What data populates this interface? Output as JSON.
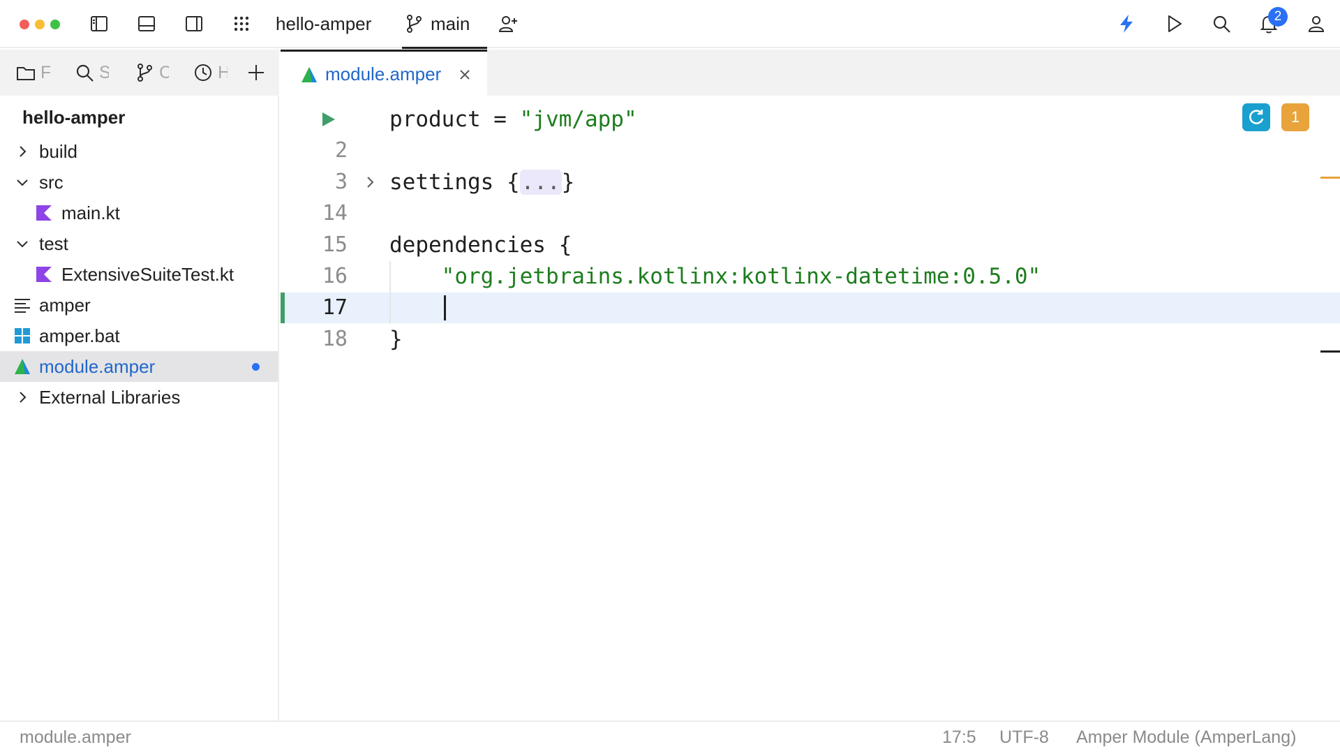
{
  "window": {
    "project_name": "hello-amper",
    "branch": "main",
    "notification_count": "2",
    "colors": {
      "close": "#f25f58",
      "minimize": "#f9be33",
      "zoom": "#3ec244",
      "accent": "#2970f5"
    }
  },
  "toolbar": {
    "icons": [
      "toggle-project-panel-icon",
      "toggle-bottom-panel-icon",
      "toggle-right-panel-icon",
      "apps-grid-icon",
      "branch-icon",
      "add-user-icon",
      "power-save-icon",
      "run-icon",
      "search-icon",
      "bell-icon",
      "account-icon"
    ]
  },
  "sidebar": {
    "tabs": [
      {
        "icon": "folder-icon",
        "label": "F"
      },
      {
        "icon": "search-icon",
        "label": "S"
      },
      {
        "icon": "commit-icon",
        "label": "C"
      },
      {
        "icon": "history-icon",
        "label": "H"
      }
    ],
    "root": "hello-amper",
    "items": [
      {
        "label": "build",
        "type": "folder",
        "expanded": false
      },
      {
        "label": "src",
        "type": "folder",
        "expanded": true
      },
      {
        "label": "main.kt",
        "type": "kotlin-file"
      },
      {
        "label": "test",
        "type": "folder",
        "expanded": true
      },
      {
        "label": "ExtensiveSuiteTest.kt",
        "type": "kotlin-file"
      },
      {
        "label": "amper",
        "type": "text-file"
      },
      {
        "label": "amper.bat",
        "type": "windows-file"
      },
      {
        "label": "module.amper",
        "type": "amper-file",
        "selected": true,
        "modified": true
      },
      {
        "label": "External Libraries",
        "type": "library",
        "expanded": false
      }
    ]
  },
  "editor": {
    "tab": {
      "label": "module.amper"
    },
    "lines": [
      {
        "num": "",
        "kw": "product = ",
        "str": "\"jvm/app\""
      },
      {
        "num": "2"
      },
      {
        "num": "3",
        "kw": "settings {",
        "fold": "...",
        "tail": "}"
      },
      {
        "num": "14"
      },
      {
        "num": "15",
        "kw": "dependencies {"
      },
      {
        "num": "16",
        "indent": "    ",
        "str": "\"org.jetbrains.kotlinx:kotlinx-datetime:0.5.0\""
      },
      {
        "num": "17"
      },
      {
        "num": "18",
        "kw": "}"
      }
    ],
    "inspection_count": "1"
  },
  "status": {
    "file": "module.amper",
    "position": "17:5",
    "encoding": "UTF-8",
    "language": "Amper Module (AmperLang)"
  }
}
